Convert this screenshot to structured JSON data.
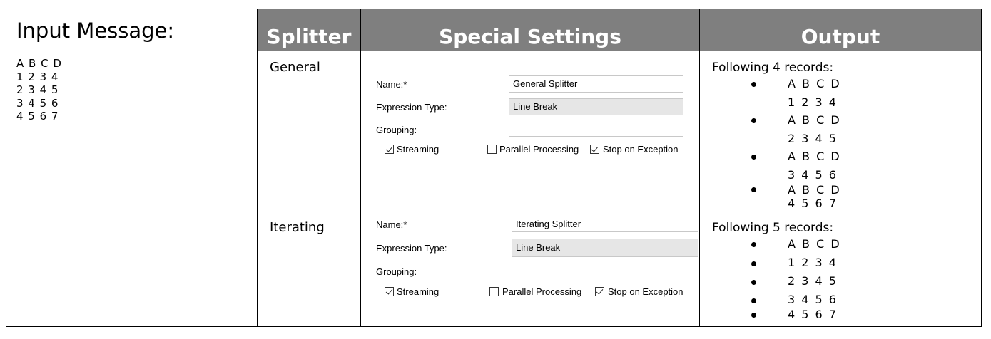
{
  "input": {
    "title": "Input Message:",
    "lines": [
      "A B C D",
      "1 2 3 4",
      "2 3 4 5",
      "3 4 5 6",
      "4 5 6 7"
    ]
  },
  "headers": {
    "splitter": "Splitter",
    "settings": "Special Settings",
    "output": "Output"
  },
  "rows": [
    {
      "splitter": "General",
      "form": {
        "name_label": "Name:*",
        "name_value": "General Splitter",
        "expr_label": "Expression Type:",
        "expr_value": "Line Break",
        "grouping_label": "Grouping:",
        "grouping_value": "",
        "streaming_label": "Streaming",
        "streaming_checked": true,
        "parallel_label": "Parallel Processing",
        "parallel_checked": false,
        "stop_label": "Stop on Exception",
        "stop_checked": true
      },
      "output": {
        "title": "Following 4 records:",
        "records": [
          [
            "A B C D",
            "1 2 3 4"
          ],
          [
            "A B C D",
            "2 3 4 5"
          ],
          [
            "A B C D",
            "3 4 5 6"
          ],
          [
            "A B C D",
            "4 5 6 7"
          ]
        ]
      }
    },
    {
      "splitter": "Iterating",
      "form": {
        "name_label": "Name:*",
        "name_value": "Iterating Splitter",
        "expr_label": "Expression Type:",
        "expr_value": "Line Break",
        "grouping_label": "Grouping:",
        "grouping_value": "",
        "streaming_label": "Streaming",
        "streaming_checked": true,
        "parallel_label": "Parallel Processing",
        "parallel_checked": false,
        "stop_label": "Stop on Exception",
        "stop_checked": true
      },
      "output": {
        "title": "Following 5 records:",
        "records": [
          [
            "A B C D"
          ],
          [
            "1 2 3 4"
          ],
          [
            "2 3 4 5"
          ],
          [
            "3 4 5 6"
          ],
          [
            "4 5 6 7"
          ]
        ]
      }
    }
  ]
}
